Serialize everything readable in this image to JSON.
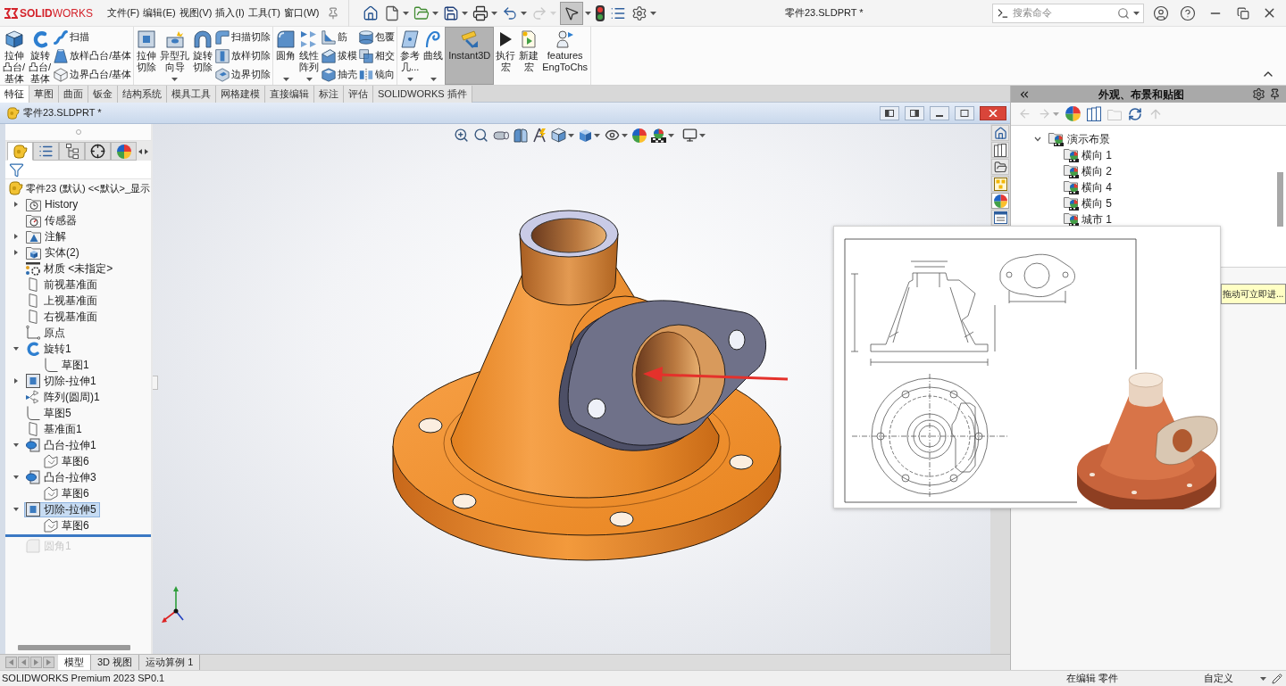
{
  "title_bar": {
    "logo": "**SOLID**WORKS",
    "menu": [
      "文件(F)",
      "编辑(E)",
      "视图(V)",
      "插入(I)",
      "工具(T)",
      "窗口(W)"
    ],
    "quick_access": [
      {
        "on": false,
        "disabled": false
      },
      {
        "on": false,
        "disabled": false
      },
      {
        "on": false,
        "disabled": false
      },
      {
        "on": false,
        "disabled": false
      },
      {
        "on": false,
        "disabled": false
      },
      {
        "on": false,
        "disabled": false
      },
      {
        "on": false,
        "disabled": true
      },
      {
        "on": true,
        "disabled": false
      },
      {
        "on": false,
        "disabled": false
      },
      {
        "on": false,
        "disabled": false
      },
      {
        "on": false,
        "disabled": false
      }
    ],
    "document_title": "零件23.SLDPRT *",
    "search": {
      "placeholder": "搜索命令"
    }
  },
  "ribbon": {
    "groups": [
      {
        "items": [
          {
            "kind": "large",
            "lines": [
              "拉伸",
              "凸台/",
              "基体"
            ],
            "on": false
          },
          {
            "kind": "large",
            "lines": [
              "旋转",
              "凸台/",
              "基体"
            ],
            "on": false
          },
          {
            "kind": "column",
            "buttons": [
              {
                "label": "扫描"
              },
              {
                "label": "放样凸台/基体"
              },
              {
                "label": "边界凸台/基体"
              }
            ]
          }
        ]
      },
      {
        "items": [
          {
            "kind": "large",
            "lines": [
              "拉伸",
              "切除"
            ],
            "on": false
          },
          {
            "kind": "large",
            "lines": [
              "异型孔",
              "向导"
            ],
            "on": false,
            "dropdown": true
          },
          {
            "kind": "large",
            "lines": [
              "旋转",
              "切除"
            ],
            "on": false
          },
          {
            "kind": "column",
            "buttons": [
              {
                "label": "扫描切除"
              },
              {
                "label": "放样切除"
              },
              {
                "label": "边界切除"
              }
            ]
          }
        ]
      },
      {
        "items": [
          {
            "kind": "large",
            "lines": [
              "圆角"
            ],
            "on": false,
            "dropdown": true
          },
          {
            "kind": "large",
            "lines": [
              "线性",
              "阵列"
            ],
            "on": false,
            "dropdown": true
          },
          {
            "kind": "column",
            "buttons": [
              {
                "label": "筋"
              },
              {
                "label": "拔模"
              },
              {
                "label": "抽壳"
              }
            ]
          },
          {
            "kind": "column",
            "buttons": [
              {
                "label": "包覆"
              },
              {
                "label": "相交"
              },
              {
                "label": "镜向"
              }
            ]
          }
        ]
      },
      {
        "items": [
          {
            "kind": "large",
            "lines": [
              "参考",
              "几..."
            ],
            "on": false,
            "dropdown": true
          },
          {
            "kind": "large",
            "lines": [
              "曲线"
            ],
            "on": false,
            "dropdown": true
          },
          {
            "kind": "large",
            "lines": [
              "Instant3D"
            ],
            "on": true
          },
          {
            "kind": "large",
            "lines": [
              "执行",
              "宏"
            ],
            "on": false
          },
          {
            "kind": "large",
            "lines": [
              "新建",
              "宏"
            ],
            "on": false
          },
          {
            "kind": "large",
            "lines": [
              "features",
              "EngToChs"
            ],
            "on": false
          }
        ]
      }
    ],
    "tabs": [
      {
        "label": "特征",
        "selected": true
      },
      {
        "label": "草图",
        "selected": false
      },
      {
        "label": "曲面",
        "selected": false
      },
      {
        "label": "钣金",
        "selected": false
      },
      {
        "label": "结构系统",
        "selected": false
      },
      {
        "label": "模具工具",
        "selected": false
      },
      {
        "label": "网格建模",
        "selected": false
      },
      {
        "label": "直接编辑",
        "selected": false
      },
      {
        "label": "标注",
        "selected": false
      },
      {
        "label": "评估",
        "selected": false
      },
      {
        "label": "SOLIDWORKS 插件",
        "selected": false
      }
    ]
  },
  "document_window": {
    "title": "零件23.SLDPRT *"
  },
  "feature_manager": {
    "tabs": [
      {
        "selected": true
      },
      {
        "selected": false
      },
      {
        "selected": false
      },
      {
        "selected": false
      },
      {
        "selected": false
      }
    ],
    "root": "零件23 (默认) <<默认>_显示",
    "items": [
      {
        "label": "History",
        "kind": "history",
        "expanded": false,
        "selected": false
      },
      {
        "label": "传感器",
        "kind": "sensors",
        "selected": false
      },
      {
        "label": "注解",
        "kind": "annotations",
        "expanded": false,
        "selected": false
      },
      {
        "label": "实体(2)",
        "kind": "bodies",
        "expanded": false,
        "selected": false
      },
      {
        "label": "材质 <未指定>",
        "kind": "material",
        "selected": false
      },
      {
        "label": "前视基准面",
        "kind": "plane",
        "selected": false
      },
      {
        "label": "上视基准面",
        "kind": "plane",
        "selected": false
      },
      {
        "label": "右视基准面",
        "kind": "plane",
        "selected": false
      },
      {
        "label": "原点",
        "kind": "origin",
        "selected": false
      },
      {
        "label": "旋转1",
        "kind": "revolve",
        "expanded": true,
        "selected": false,
        "children": [
          {
            "label": "草图1",
            "kind": "sketch",
            "selected": false
          }
        ]
      },
      {
        "label": "切除-拉伸1",
        "kind": "cut",
        "expanded": false,
        "selected": false
      },
      {
        "label": "阵列(圆周)1",
        "kind": "pattern",
        "selected": false
      },
      {
        "label": "草图5",
        "kind": "sketch",
        "selected": false
      },
      {
        "label": "基准面1",
        "kind": "plane",
        "selected": false
      },
      {
        "label": "凸台-拉伸1",
        "kind": "boss",
        "expanded": true,
        "selected": false,
        "children": [
          {
            "label": "草图6",
            "kind": "profile",
            "selected": false
          }
        ]
      },
      {
        "label": "凸台-拉伸3",
        "kind": "boss",
        "expanded": true,
        "selected": false,
        "children": [
          {
            "label": "草图6",
            "kind": "profile",
            "selected": false
          }
        ]
      },
      {
        "label": "切除-拉伸5",
        "kind": "cut",
        "expanded": true,
        "selected": true,
        "children": [
          {
            "label": "草图6",
            "kind": "profile",
            "selected": false
          }
        ]
      }
    ],
    "rolled_back": [
      {
        "label": "圆角1",
        "kind": "fillet",
        "selected": false
      }
    ]
  },
  "task_pane_tabs": [
    {
      "selected": false
    },
    {
      "selected": false
    },
    {
      "selected": false
    },
    {
      "selected": false
    },
    {
      "selected": true
    },
    {
      "selected": false
    }
  ],
  "bottom_tabs": [
    {
      "label": "模型",
      "selected": true
    },
    {
      "label": "3D 视图",
      "selected": false
    },
    {
      "label": "运动算例 1",
      "selected": false
    }
  ],
  "appearance_panel": {
    "title": "外观、布景和贴图",
    "toolbar": [
      {
        "disabled": true
      },
      {
        "disabled": true
      },
      {
        "disabled": false
      },
      {
        "disabled": false
      },
      {
        "disabled": true
      },
      {
        "disabled": false
      },
      {
        "disabled": true
      }
    ],
    "tree": [
      {
        "label": "演示布景",
        "expanded": true,
        "selected": false,
        "children": [
          {
            "label": "横向 1",
            "selected": false
          },
          {
            "label": "横向 2",
            "selected": false
          },
          {
            "label": "横向 4",
            "selected": false
          },
          {
            "label": "横向 5",
            "selected": false
          },
          {
            "label": "城市 1",
            "selected": false
          }
        ]
      }
    ],
    "tooltip": "拖动可立即进..."
  },
  "status_bar": {
    "product": "SOLIDWORKS Premium 2023 SP0.1",
    "mode": "在编辑 零件",
    "units": "自定义"
  }
}
